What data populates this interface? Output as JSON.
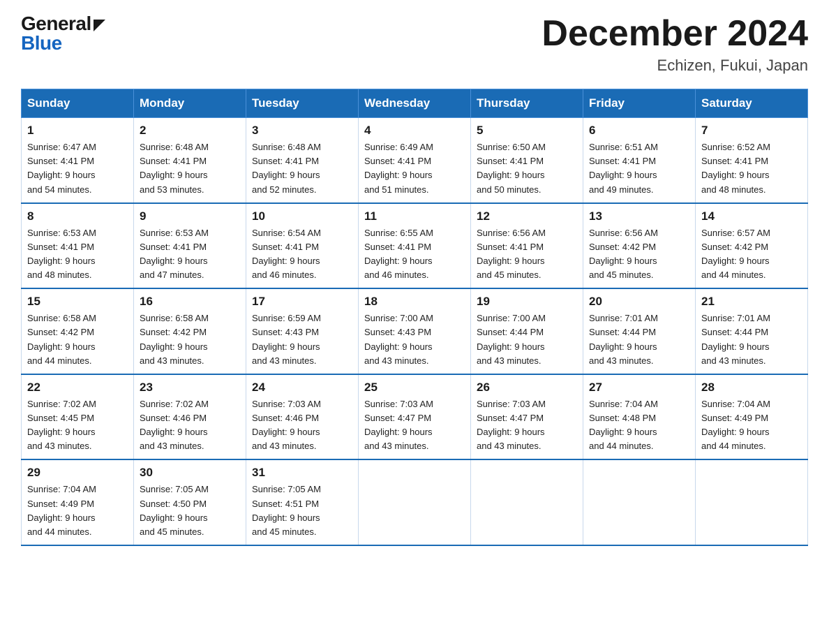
{
  "logo": {
    "general": "General",
    "blue": "Blue"
  },
  "title": "December 2024",
  "location": "Echizen, Fukui, Japan",
  "weekdays": [
    "Sunday",
    "Monday",
    "Tuesday",
    "Wednesday",
    "Thursday",
    "Friday",
    "Saturday"
  ],
  "weeks": [
    [
      {
        "day": "1",
        "sunrise": "6:47 AM",
        "sunset": "4:41 PM",
        "daylight": "9 hours and 54 minutes."
      },
      {
        "day": "2",
        "sunrise": "6:48 AM",
        "sunset": "4:41 PM",
        "daylight": "9 hours and 53 minutes."
      },
      {
        "day": "3",
        "sunrise": "6:48 AM",
        "sunset": "4:41 PM",
        "daylight": "9 hours and 52 minutes."
      },
      {
        "day": "4",
        "sunrise": "6:49 AM",
        "sunset": "4:41 PM",
        "daylight": "9 hours and 51 minutes."
      },
      {
        "day": "5",
        "sunrise": "6:50 AM",
        "sunset": "4:41 PM",
        "daylight": "9 hours and 50 minutes."
      },
      {
        "day": "6",
        "sunrise": "6:51 AM",
        "sunset": "4:41 PM",
        "daylight": "9 hours and 49 minutes."
      },
      {
        "day": "7",
        "sunrise": "6:52 AM",
        "sunset": "4:41 PM",
        "daylight": "9 hours and 48 minutes."
      }
    ],
    [
      {
        "day": "8",
        "sunrise": "6:53 AM",
        "sunset": "4:41 PM",
        "daylight": "9 hours and 48 minutes."
      },
      {
        "day": "9",
        "sunrise": "6:53 AM",
        "sunset": "4:41 PM",
        "daylight": "9 hours and 47 minutes."
      },
      {
        "day": "10",
        "sunrise": "6:54 AM",
        "sunset": "4:41 PM",
        "daylight": "9 hours and 46 minutes."
      },
      {
        "day": "11",
        "sunrise": "6:55 AM",
        "sunset": "4:41 PM",
        "daylight": "9 hours and 46 minutes."
      },
      {
        "day": "12",
        "sunrise": "6:56 AM",
        "sunset": "4:41 PM",
        "daylight": "9 hours and 45 minutes."
      },
      {
        "day": "13",
        "sunrise": "6:56 AM",
        "sunset": "4:42 PM",
        "daylight": "9 hours and 45 minutes."
      },
      {
        "day": "14",
        "sunrise": "6:57 AM",
        "sunset": "4:42 PM",
        "daylight": "9 hours and 44 minutes."
      }
    ],
    [
      {
        "day": "15",
        "sunrise": "6:58 AM",
        "sunset": "4:42 PM",
        "daylight": "9 hours and 44 minutes."
      },
      {
        "day": "16",
        "sunrise": "6:58 AM",
        "sunset": "4:42 PM",
        "daylight": "9 hours and 43 minutes."
      },
      {
        "day": "17",
        "sunrise": "6:59 AM",
        "sunset": "4:43 PM",
        "daylight": "9 hours and 43 minutes."
      },
      {
        "day": "18",
        "sunrise": "7:00 AM",
        "sunset": "4:43 PM",
        "daylight": "9 hours and 43 minutes."
      },
      {
        "day": "19",
        "sunrise": "7:00 AM",
        "sunset": "4:44 PM",
        "daylight": "9 hours and 43 minutes."
      },
      {
        "day": "20",
        "sunrise": "7:01 AM",
        "sunset": "4:44 PM",
        "daylight": "9 hours and 43 minutes."
      },
      {
        "day": "21",
        "sunrise": "7:01 AM",
        "sunset": "4:44 PM",
        "daylight": "9 hours and 43 minutes."
      }
    ],
    [
      {
        "day": "22",
        "sunrise": "7:02 AM",
        "sunset": "4:45 PM",
        "daylight": "9 hours and 43 minutes."
      },
      {
        "day": "23",
        "sunrise": "7:02 AM",
        "sunset": "4:46 PM",
        "daylight": "9 hours and 43 minutes."
      },
      {
        "day": "24",
        "sunrise": "7:03 AM",
        "sunset": "4:46 PM",
        "daylight": "9 hours and 43 minutes."
      },
      {
        "day": "25",
        "sunrise": "7:03 AM",
        "sunset": "4:47 PM",
        "daylight": "9 hours and 43 minutes."
      },
      {
        "day": "26",
        "sunrise": "7:03 AM",
        "sunset": "4:47 PM",
        "daylight": "9 hours and 43 minutes."
      },
      {
        "day": "27",
        "sunrise": "7:04 AM",
        "sunset": "4:48 PM",
        "daylight": "9 hours and 44 minutes."
      },
      {
        "day": "28",
        "sunrise": "7:04 AM",
        "sunset": "4:49 PM",
        "daylight": "9 hours and 44 minutes."
      }
    ],
    [
      {
        "day": "29",
        "sunrise": "7:04 AM",
        "sunset": "4:49 PM",
        "daylight": "9 hours and 44 minutes."
      },
      {
        "day": "30",
        "sunrise": "7:05 AM",
        "sunset": "4:50 PM",
        "daylight": "9 hours and 45 minutes."
      },
      {
        "day": "31",
        "sunrise": "7:05 AM",
        "sunset": "4:51 PM",
        "daylight": "9 hours and 45 minutes."
      },
      null,
      null,
      null,
      null
    ]
  ]
}
